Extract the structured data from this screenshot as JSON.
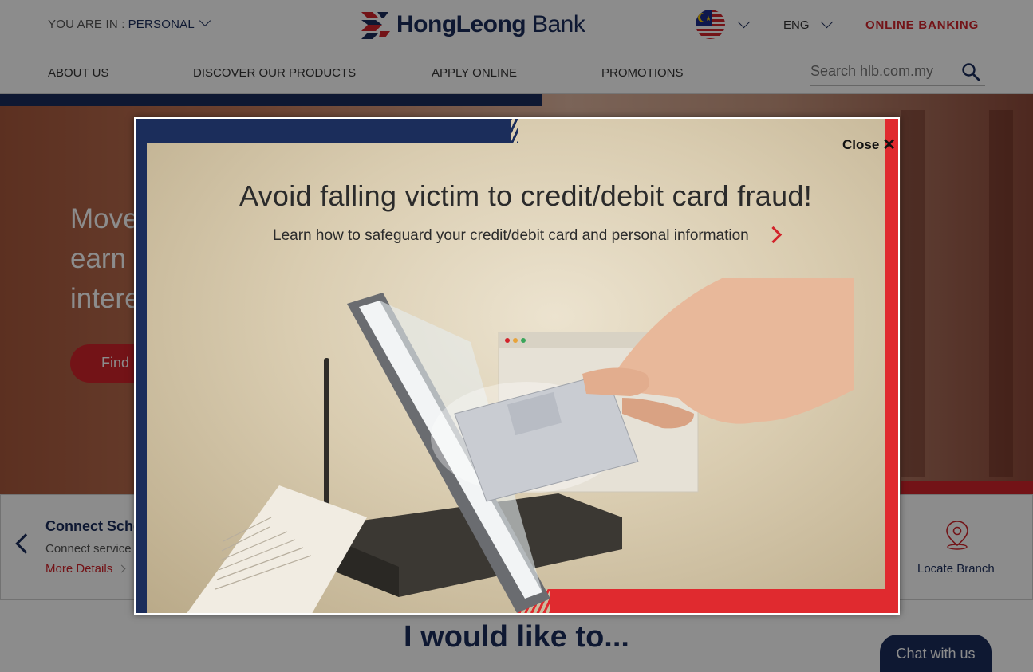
{
  "topbar": {
    "you_are_in_label": "YOU ARE IN :",
    "segment_value": "PERSONAL",
    "brand_name_bold": "HongLeong",
    "brand_name_light": " Bank",
    "language": "ENG",
    "online_banking": "ONLINE BANKING"
  },
  "nav": {
    "items": [
      "ABOUT US",
      "DISCOVER OUR PRODUCTS",
      "APPLY ONLINE",
      "PROMOTIONS"
    ],
    "search_placeholder": "Search hlb.com.my"
  },
  "hero": {
    "lines": [
      "Move",
      "earn u",
      "intere"
    ],
    "cta": "Find"
  },
  "quick_strip": {
    "title": "Connect Sche",
    "subtitle": "Connect service",
    "more": "More Details",
    "locate": "Locate Branch"
  },
  "section_title": "I would like to...",
  "chat": "Chat with us",
  "modal": {
    "close_label": "Close",
    "close_glyph": "✕",
    "title": "Avoid falling victim to credit/debit card fraud!",
    "subtitle": "Learn how to safeguard your credit/debit card and personal information"
  },
  "colors": {
    "brand_navy": "#1b2d5b",
    "brand_red": "#d2232a"
  }
}
